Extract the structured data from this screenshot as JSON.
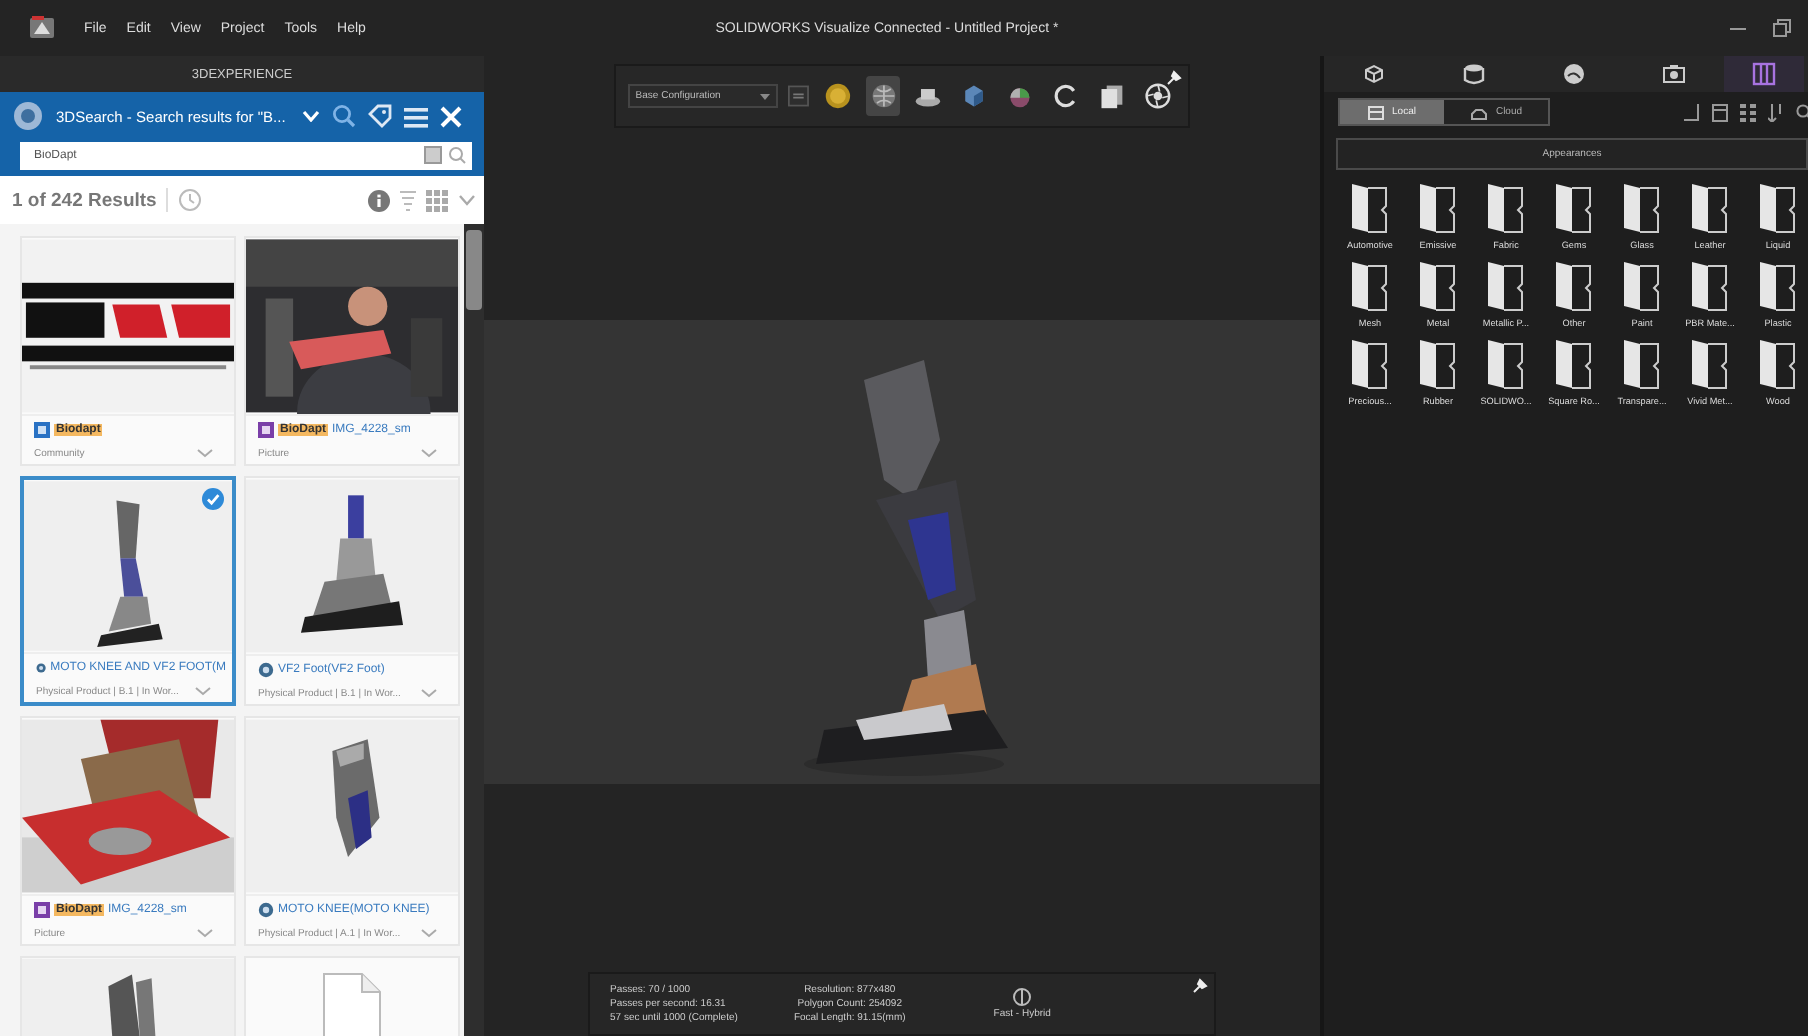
{
  "app": {
    "title": "SOLIDWORKS Visualize Connected - Untitled Project *",
    "menu": [
      "File",
      "Edit",
      "View",
      "Project",
      "Tools",
      "Help"
    ]
  },
  "search_panel": {
    "header": "3DEXPERIENCE",
    "app_title": "3DSearch - Search results for \"B...",
    "search": {
      "value": "BioDapt"
    },
    "results": "1 of 242 Results",
    "cards": [
      {
        "kind": "community",
        "highlight": "Biodapt",
        "subtitle": "Community",
        "selected": false
      },
      {
        "kind": "picture",
        "highlight": "BioDapt",
        "title": "IMG_4228_sm",
        "subtitle": "Picture",
        "selected": false
      },
      {
        "kind": "product",
        "title": "MOTO KNEE AND VF2 FOOT(M",
        "subtitle": "Physical Product | B.1 | In Wor...",
        "selected": true
      },
      {
        "kind": "product",
        "title": "VF2 Foot(VF2 Foot)",
        "subtitle": "Physical Product | B.1 | In Wor...",
        "selected": false
      },
      {
        "kind": "picture",
        "highlight": "BioDapt",
        "title": "IMG_4228_sm",
        "subtitle": "Picture",
        "selected": false
      },
      {
        "kind": "product",
        "title": "MOTO KNEE(MOTO KNEE)",
        "subtitle": "Physical Product | A.1 | In Wor...",
        "selected": false
      },
      {
        "selected": false
      },
      {
        "preview": {
          "kind": "document"
        },
        "selected": false
      }
    ]
  },
  "viewport": {
    "toolbar": {
      "configuration": "Base Configuration",
      "tools": [
        {
          "selected": false
        },
        {
          "selected": true
        },
        {
          "selected": false
        },
        {
          "selected": false
        },
        {
          "selected": false
        },
        {
          "selected": false
        },
        {
          "selected": false
        },
        {
          "selected": false
        }
      ]
    },
    "stats": {
      "progress": [
        "Passes: 70 / 1000",
        "Passes per second: 16.31",
        "57 sec until 1000 (Complete)"
      ],
      "scene": [
        "Resolution: 877x480",
        "Polygon Count: 254092",
        "Focal Length: 91.15(mm)"
      ],
      "mode": "Fast - Hybrid"
    }
  },
  "library": {
    "tabs": [
      {
        "selected": false
      },
      {
        "selected": false
      },
      {
        "selected": false
      },
      {
        "selected": false
      },
      {
        "selected": true
      }
    ],
    "sources": [
      {
        "label": "Local",
        "selected": true
      },
      {
        "label": "Cloud",
        "selected": false
      }
    ],
    "category": "Appearances",
    "folders": [
      "Automotive",
      "Emissive",
      "Fabric",
      "Gems",
      "Glass",
      "Leather",
      "Liquid",
      "Mesh",
      "Metal",
      "Metallic P...",
      "Other",
      "Paint",
      "PBR Mate...",
      "Plastic",
      "Precious...",
      "Rubber",
      "SOLIDWO...",
      "Square Ro...",
      "Transpare...",
      "Vivid Met...",
      "Wood"
    ]
  }
}
